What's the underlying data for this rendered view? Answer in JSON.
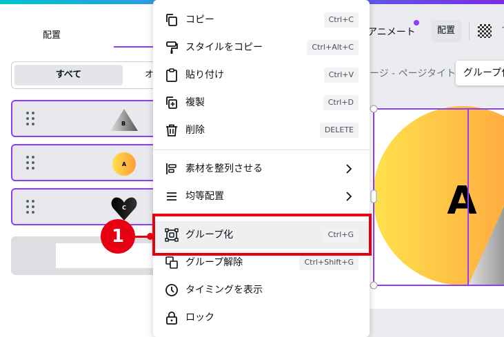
{
  "left_panel": {
    "tab_label": "配置",
    "segment_all": "すべて",
    "segment_other": "オ",
    "layers": [
      {
        "thumb": "B",
        "shape": "triangle"
      },
      {
        "thumb": "A",
        "shape": "circle"
      },
      {
        "thumb": "C",
        "shape": "heart"
      }
    ]
  },
  "header": {
    "animate_label": "アニメート",
    "position_button": "配置",
    "more_label": "˙"
  },
  "canvas": {
    "page_title": "ージ - ページタイトル",
    "group_tooltip": "グループ化",
    "design_letter": "A"
  },
  "context_menu": {
    "items": [
      {
        "label": "コピー",
        "shortcut": "Ctrl+C",
        "icon": "copy-icon"
      },
      {
        "label": "スタイルをコピー",
        "shortcut": "Ctrl+Alt+C",
        "icon": "paint-roller-icon"
      },
      {
        "label": "貼り付け",
        "shortcut": "Ctrl+V",
        "icon": "clipboard-icon"
      },
      {
        "label": "複製",
        "shortcut": "Ctrl+D",
        "icon": "duplicate-icon"
      },
      {
        "label": "削除",
        "shortcut": "DELETE",
        "icon": "trash-icon"
      },
      {
        "label": "素材を整列させる",
        "shortcut": "",
        "icon": "align-icon"
      },
      {
        "label": "均等配置",
        "shortcut": "",
        "icon": "distribute-icon"
      },
      {
        "label": "グループ化",
        "shortcut": "Ctrl+G",
        "icon": "group-icon"
      },
      {
        "label": "グループ解除",
        "shortcut": "Ctrl+Shift+G",
        "icon": "ungroup-icon"
      },
      {
        "label": "タイミングを表示",
        "shortcut": "",
        "icon": "clock-icon"
      },
      {
        "label": "ロック",
        "shortcut": "",
        "icon": "lock-icon"
      }
    ]
  },
  "annotation": {
    "step_number": "1",
    "color": "#e60012"
  },
  "colors": {
    "accent": "#8b3dff",
    "highlight_red": "#e60012"
  }
}
